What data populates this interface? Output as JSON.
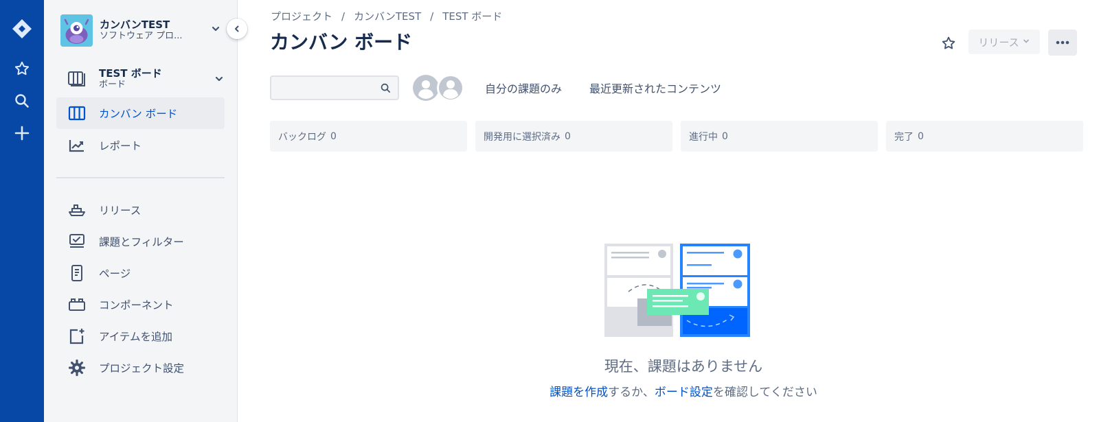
{
  "global_nav": {
    "items": [
      {
        "icon": "jira-logo-icon"
      },
      {
        "icon": "star-icon"
      },
      {
        "icon": "search-icon"
      },
      {
        "icon": "plus-icon"
      }
    ]
  },
  "project": {
    "name": "カンバンTEST",
    "type": "ソフトウェア プロ..."
  },
  "board_switcher": {
    "name": "TEST ボード",
    "subtitle": "ボード"
  },
  "sidebar": {
    "items": [
      {
        "label": "カンバン ボード",
        "icon": "board-icon",
        "selected": true
      },
      {
        "label": "レポート",
        "icon": "chart-icon"
      },
      {
        "label": "リリース",
        "icon": "ship-icon"
      },
      {
        "label": "課題とフィルター",
        "icon": "issues-icon"
      },
      {
        "label": "ページ",
        "icon": "page-icon"
      },
      {
        "label": "コンポーネント",
        "icon": "component-icon"
      },
      {
        "label": "アイテムを追加",
        "icon": "add-item-icon"
      },
      {
        "label": "プロジェクト設定",
        "icon": "settings-icon"
      }
    ]
  },
  "breadcrumb": [
    "プロジェクト",
    "カンバンTEST",
    "TEST ボード"
  ],
  "page_title": "カンバン ボード",
  "header_actions": {
    "release_label": "リリース"
  },
  "filters": {
    "search_placeholder": "",
    "quick_filters": [
      "自分の課題のみ",
      "最近更新されたコンテンツ"
    ]
  },
  "columns": [
    {
      "name": "バックログ",
      "count": "0"
    },
    {
      "name": "開発用に選択済み",
      "count": "0"
    },
    {
      "name": "進行中",
      "count": "0"
    },
    {
      "name": "完了",
      "count": "0"
    }
  ],
  "empty_state": {
    "title": "現在、課題はありません",
    "link1": "課題を作成",
    "mid": "するか、",
    "link2": "ボード設定",
    "tail": "を確認してください"
  },
  "colors": {
    "global_nav_bg": "#0747A6",
    "accent": "#0052CC",
    "sidebar_bg": "#F4F5F7"
  }
}
